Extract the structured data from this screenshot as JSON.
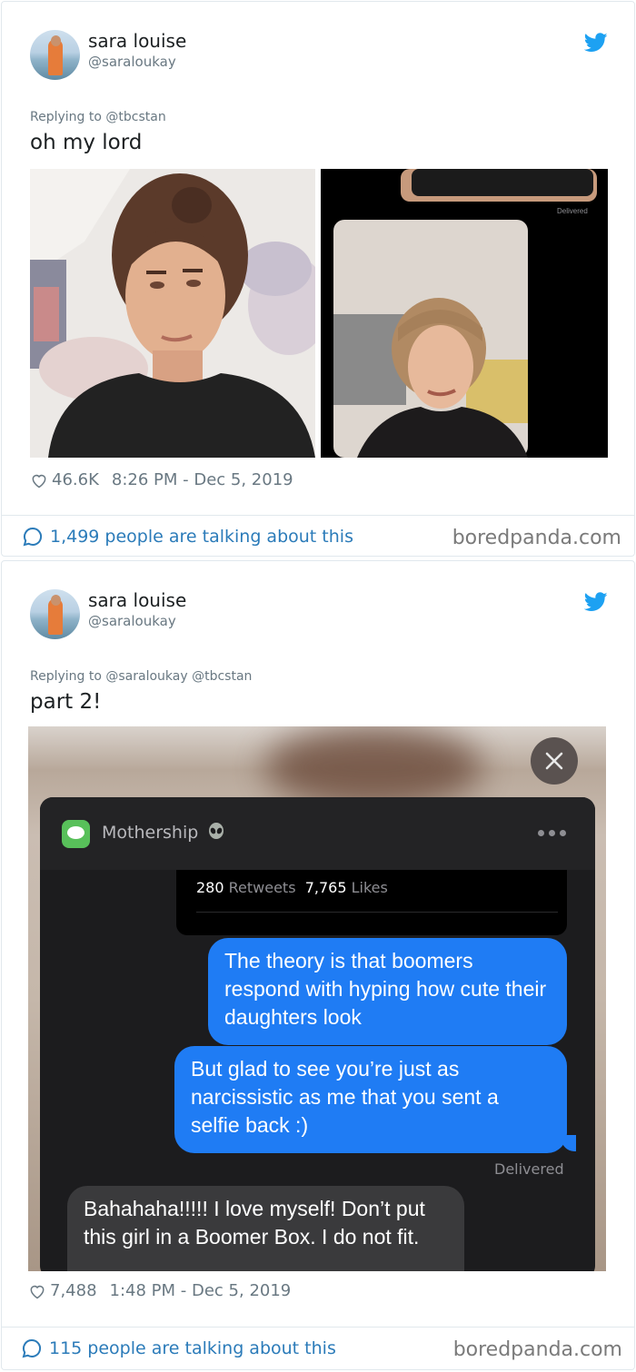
{
  "tweets": [
    {
      "user": {
        "display_name": "sara louise",
        "handle": "@saraloukay"
      },
      "reply_to": "Replying to @tbcstan",
      "text": "oh my lord",
      "photos": [
        {
          "description": "selfie of young woman"
        },
        {
          "description": "selfie of older woman",
          "overlay_text": "Delivered"
        }
      ],
      "likes": "46.6K",
      "timestamp": "8:26 PM - Dec 5, 2019",
      "talking": "1,499 people are talking about this",
      "watermark": "boredpanda.com"
    },
    {
      "user": {
        "display_name": "sara louise",
        "handle": "@saraloukay"
      },
      "reply_to": "Replying to @saraloukay @tbcstan",
      "text": "part 2!",
      "screenshot": {
        "conversation_name": "Mothership",
        "quoted_retweets": "280",
        "quoted_retweets_label": "Retweets",
        "quoted_likes": "7,765",
        "quoted_likes_label": "Likes",
        "messages": [
          {
            "from": "me",
            "text": "The theory is that boomers respond with hyping how cute their daughters look"
          },
          {
            "from": "me",
            "text": "But glad to see you’re just as narcissistic as me that you sent a selfie back :)"
          },
          {
            "from": "them",
            "text": "Bahahaha!!!!! I love myself!  Don’t put this girl in a Boomer Box.  I do not fit."
          }
        ],
        "status": "Delivered"
      },
      "likes": "7,488",
      "timestamp": "1:48 PM - Dec 5, 2019",
      "talking": "115 people are talking about this",
      "watermark": "boredpanda.com"
    }
  ],
  "colors": {
    "link": "#2b7bb9",
    "twitter_blue": "#1da1f2",
    "imessage_blue": "#1f7cf4"
  }
}
